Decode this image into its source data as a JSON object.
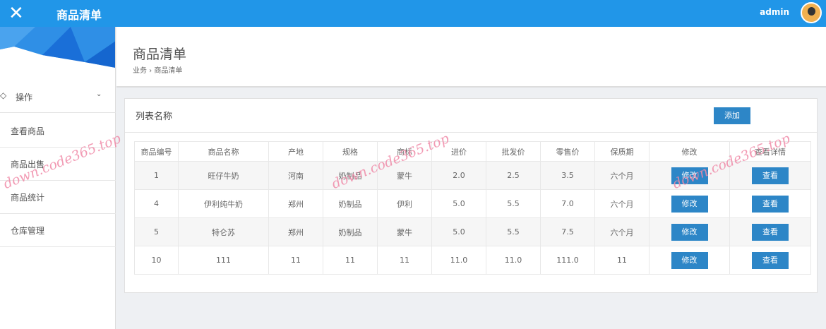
{
  "header": {
    "title": "商品清单",
    "user": "admin",
    "close_icon": "close-icon"
  },
  "sidebar": {
    "group": "操作",
    "items": [
      {
        "label": "查看商品"
      },
      {
        "label": "商品出售"
      },
      {
        "label": "商品统计"
      },
      {
        "label": "仓库管理"
      }
    ]
  },
  "page": {
    "title": "商品清单",
    "breadcrumb": "业务 › 商品清单"
  },
  "panel": {
    "title": "列表名称",
    "add_label": "添加"
  },
  "table": {
    "headers": [
      "商品编号",
      "商品名称",
      "产地",
      "规格",
      "商标",
      "进价",
      "批发价",
      "零售价",
      "保质期",
      "修改",
      "查看详情"
    ],
    "edit_label": "修改",
    "view_label": "查看",
    "rows": [
      [
        "1",
        "旺仔牛奶",
        "河南",
        "奶制品",
        "蒙牛",
        "2.0",
        "2.5",
        "3.5",
        "六个月"
      ],
      [
        "4",
        "伊利纯牛奶",
        "郑州",
        "奶制品",
        "伊利",
        "5.0",
        "5.5",
        "7.0",
        "六个月"
      ],
      [
        "5",
        "特仑苏",
        "郑州",
        "奶制品",
        "蒙牛",
        "5.0",
        "5.5",
        "7.5",
        "六个月"
      ],
      [
        "10",
        "111",
        "11",
        "11",
        "11",
        "11.0",
        "11.0",
        "111.0",
        "11"
      ]
    ]
  },
  "watermark": "down.code365.top",
  "colors": {
    "topbar": "#2196e8",
    "button": "#2d86c7",
    "watermark": "#f08aa8"
  }
}
